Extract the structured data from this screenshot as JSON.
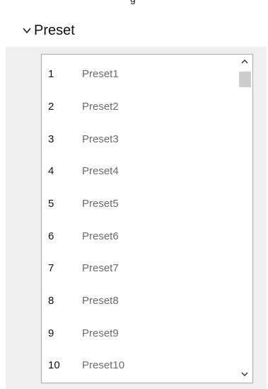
{
  "section": {
    "title": "Preset",
    "expanded_icon": "chevron-down-icon"
  },
  "presets": [
    {
      "num": "1",
      "label": "Preset1"
    },
    {
      "num": "2",
      "label": "Preset2"
    },
    {
      "num": "3",
      "label": "Preset3"
    },
    {
      "num": "4",
      "label": "Preset4"
    },
    {
      "num": "5",
      "label": "Preset5"
    },
    {
      "num": "6",
      "label": "Preset6"
    },
    {
      "num": "7",
      "label": "Preset7"
    },
    {
      "num": "8",
      "label": "Preset8"
    },
    {
      "num": "9",
      "label": "Preset9"
    },
    {
      "num": "10",
      "label": "Preset10"
    }
  ],
  "scrollbar": {
    "up_icon": "chevron-up-icon",
    "down_icon": "chevron-down-icon",
    "position": 0
  },
  "colors": {
    "panel_bg": "#f0f0f0",
    "list_border": "#a9a9a9",
    "label_text": "#6b6b6b",
    "number_text": "#111111",
    "thumb": "#cdcdcd"
  }
}
